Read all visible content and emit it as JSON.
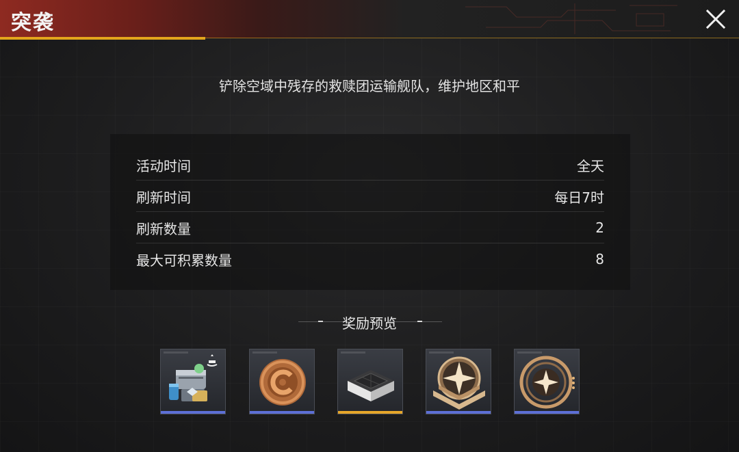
{
  "header": {
    "title": "突袭"
  },
  "description": "铲除空域中残存的救赎团运输舰队，维护地区和平",
  "info_rows": [
    {
      "label": "活动时间",
      "value": "全天"
    },
    {
      "label": "刷新时间",
      "value": "每日7时"
    },
    {
      "label": "刷新数量",
      "value": "2"
    },
    {
      "label": "最大可积累数量",
      "value": "8"
    }
  ],
  "rewards": {
    "title": "奖励预览",
    "items": [
      {
        "icon": "supply-crate-icon",
        "rarity": "blue",
        "bar_color": "#5d6fd6"
      },
      {
        "icon": "bronze-coin-icon",
        "rarity": "blue",
        "bar_color": "#5d6fd6"
      },
      {
        "icon": "material-block-icon",
        "rarity": "gold",
        "bar_color": "#e6a62a"
      },
      {
        "icon": "star-wings-badge-icon",
        "rarity": "blue",
        "bar_color": "#5d6fd6"
      },
      {
        "icon": "star-ring-token-icon",
        "rarity": "blue",
        "bar_color": "#5d6fd6"
      }
    ]
  },
  "colors": {
    "header_red": "#8e2a21",
    "accent_gold": "#e3a51c",
    "rarity_blue": "#5d6fd6",
    "rarity_gold": "#e6a62a"
  }
}
